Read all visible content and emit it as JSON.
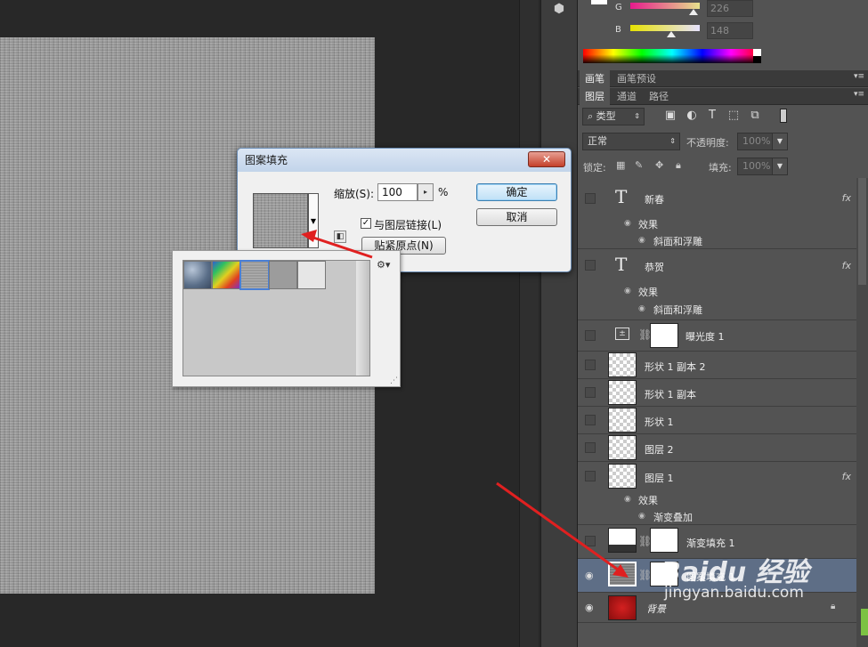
{
  "color_panel": {
    "g_label": "G",
    "g_value": "226",
    "b_label": "B",
    "b_value": "148"
  },
  "brush_tabs": [
    "画笔",
    "画笔预设"
  ],
  "layer_tabs": [
    "图层",
    "通道",
    "路径"
  ],
  "filter_kind": "类型",
  "blend_mode": "正常",
  "opacity_label": "不透明度:",
  "opacity_value": "100%",
  "lock_label": "锁定:",
  "fill_label": "填充:",
  "fill_value": "100%",
  "layers": [
    {
      "name": "新春",
      "kind": "text",
      "fx": "fx",
      "effects_label": "效果",
      "effects": [
        "斜面和浮雕"
      ]
    },
    {
      "name": "恭贺",
      "kind": "text",
      "fx": "fx",
      "effects_label": "效果",
      "effects": [
        "斜面和浮雕"
      ]
    },
    {
      "name": "曝光度 1",
      "kind": "adjustment"
    },
    {
      "name": "形状 1 副本 2",
      "kind": "shape"
    },
    {
      "name": "形状 1 副本",
      "kind": "shape"
    },
    {
      "name": "形状 1",
      "kind": "shape"
    },
    {
      "name": "图层 2",
      "kind": "pixel"
    },
    {
      "name": "图层 1",
      "kind": "pixel",
      "fx": "fx",
      "effects_label": "效果",
      "effects": [
        "渐变叠加"
      ]
    },
    {
      "name": "渐变填充 1",
      "kind": "fill"
    },
    {
      "name": "图案填充 1",
      "kind": "pattern-fill",
      "selected": true
    },
    {
      "name": "背景",
      "kind": "background"
    }
  ],
  "dialog": {
    "title": "图案填充",
    "close": "✕",
    "scale_label": "缩放(S):",
    "scale_value": "100",
    "scale_unit": "%",
    "link_checkbox": "与图层链接(L)",
    "snap_button": "贴紧原点(N)",
    "ok": "确定",
    "cancel": "取消"
  },
  "watermark": {
    "brand": "Baidu 经验",
    "url": "jingyan.baidu.com"
  },
  "colors": {
    "panel": "#535353",
    "selected_layer": "#5e6e86",
    "annotation_arrow": "#e02020"
  }
}
